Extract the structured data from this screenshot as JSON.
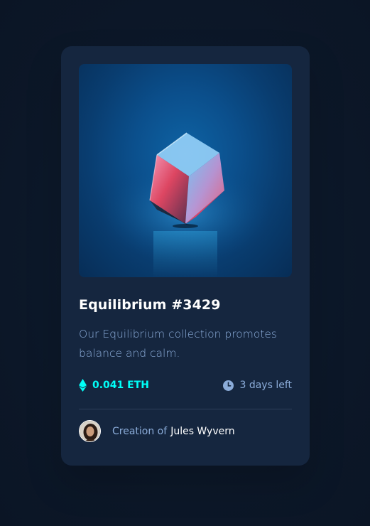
{
  "card": {
    "title": "Equilibrium #3429",
    "description": "Our Equilibrium collection promotes balance and calm.",
    "price": "0.041 ETH",
    "time_left": "3 days left",
    "creator_prefix": "Creation of",
    "creator_name": "Jules Wyvern"
  },
  "colors": {
    "page_background": "#0d1a2c",
    "card_background": "#15263f",
    "accent_cyan": "#00fff8",
    "soft_blue": "#8bacd9",
    "white": "#ffffff",
    "divider": "#2e405a"
  },
  "icons": {
    "price": "ethereum-icon",
    "time": "clock-icon"
  }
}
